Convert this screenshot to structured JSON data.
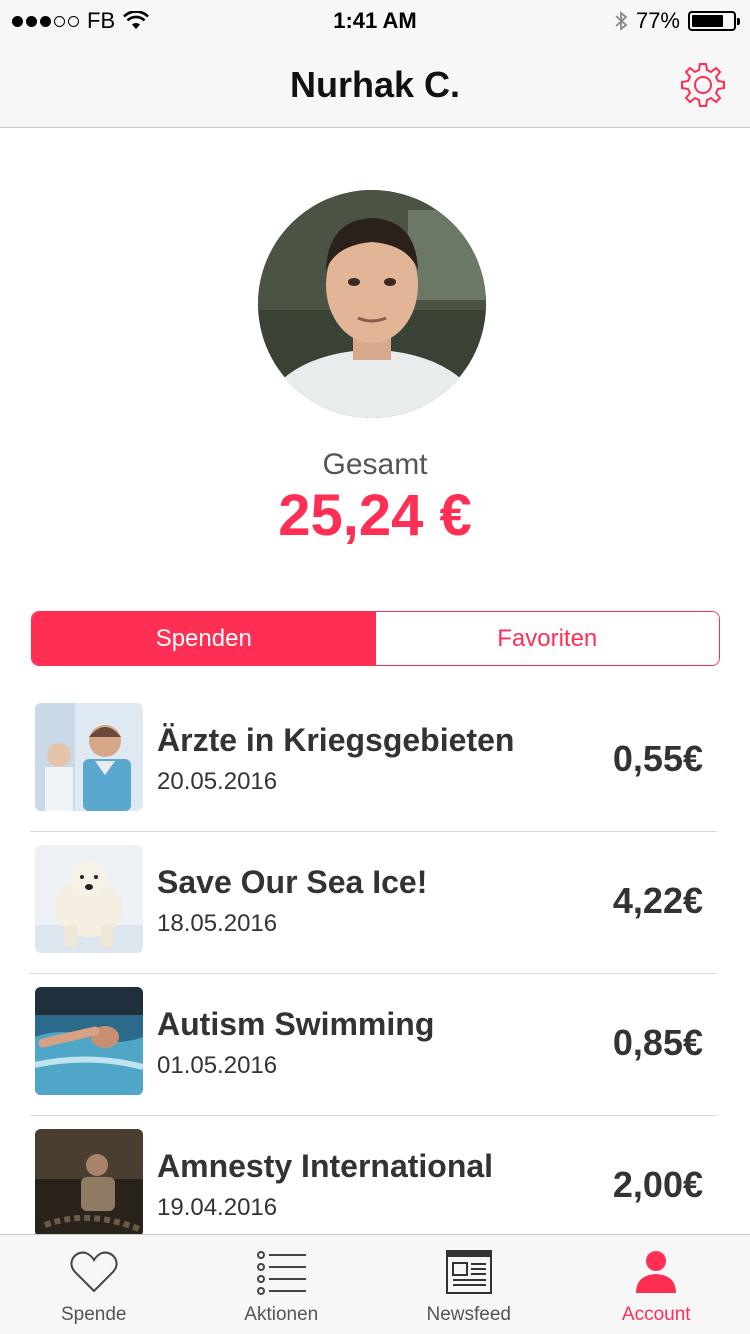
{
  "status_bar": {
    "carrier": "FB",
    "time": "1:41 AM",
    "battery_percent": "77%",
    "battery_level": 0.77,
    "signal_bars_filled": 3,
    "signal_bars_total": 5
  },
  "nav": {
    "title": "Nurhak C."
  },
  "profile": {
    "total_label": "Gesamt",
    "total_value": "25,24 €"
  },
  "segment": {
    "options": [
      "Spenden",
      "Favoriten"
    ],
    "selected": "Spenden"
  },
  "donations": [
    {
      "title": "Ärzte in Kriegsgebieten",
      "date": "20.05.2016",
      "amount": "0,55€",
      "thumbnail": "doctors-photo"
    },
    {
      "title": "Save Our Sea Ice!",
      "date": "18.05.2016",
      "amount": "4,22€",
      "thumbnail": "polar-bear-photo"
    },
    {
      "title": "Autism Swimming",
      "date": "01.05.2016",
      "amount": "0,85€",
      "thumbnail": "swimmer-photo"
    },
    {
      "title": "Amnesty International",
      "date": "19.04.2016",
      "amount": "2,00€",
      "thumbnail": "chained-person-photo"
    }
  ],
  "tabs": [
    {
      "label": "Spende",
      "icon": "heart-icon"
    },
    {
      "label": "Aktionen",
      "icon": "list-icon"
    },
    {
      "label": "Newsfeed",
      "icon": "newspaper-icon"
    },
    {
      "label": "Account",
      "icon": "person-icon"
    }
  ],
  "colors": {
    "accent": "#ff2e55",
    "text": "#333333",
    "bar_background": "#f7f7f7"
  }
}
